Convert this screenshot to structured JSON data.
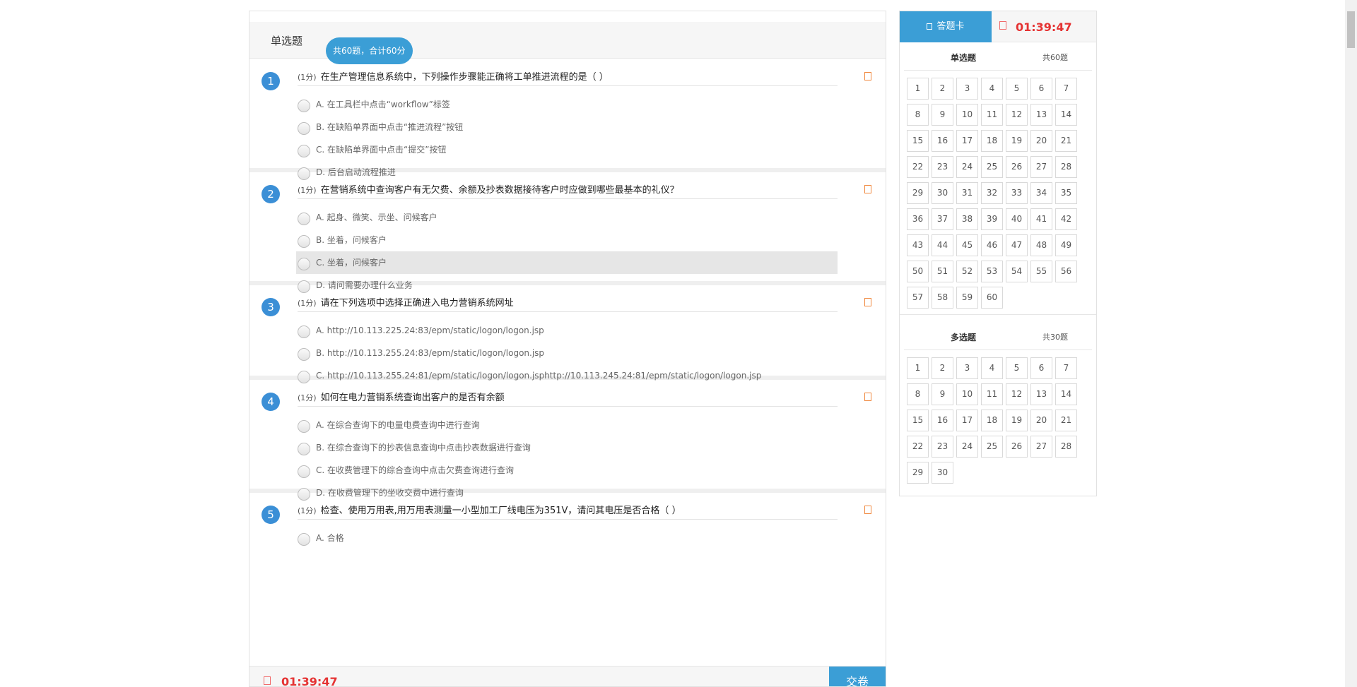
{
  "section": {
    "title": "单选题",
    "summary": "共60题，合计60分"
  },
  "questions": [
    {
      "num": "1",
      "score": "(1分)",
      "text": "在生产管理信息系统中，下列操作步骤能正确将工单推进流程的是（   ）",
      "options": [
        "A. 在工具栏中点击“workflow”标签",
        "B. 在缺陷单界面中点击“推进流程”按钮",
        "C. 在缺陷单界面中点击“提交”按钮",
        "D. 后台启动流程推进"
      ]
    },
    {
      "num": "2",
      "score": "(1分)",
      "text": "在营销系统中查询客户有无欠费、余额及抄表数据接待客户时应做到哪些最基本的礼仪？",
      "options": [
        "A. 起身、微笑、示坐、问候客户",
        "B. 坐着，问候客户",
        "C. 坐着，问候客户",
        "D. 请问需要办理什么业务"
      ]
    },
    {
      "num": "3",
      "score": "(1分)",
      "text": "请在下列选项中选择正确进入电力营销系统网址",
      "options": [
        "A. http://10.113.225.24:83/epm/static/logon/logon.jsp",
        "B. http://10.113.255.24:83/epm/static/logon/logon.jsp",
        "C. http://10.113.255.24:81/epm/static/logon/logon.jsphttp://10.113.245.24:81/epm/static/logon/logon.jsp"
      ]
    },
    {
      "num": "4",
      "score": "(1分)",
      "text": "如何在电力营销系统查询出客户的是否有余额",
      "options": [
        "A. 在综合查询下的电量电费查询中进行查询",
        "B. 在综合查询下的抄表信息查询中点击抄表数据进行查询",
        "C. 在收费管理下的综合查询中点击欠费查询进行查询",
        "D. 在收费管理下的坐收交费中进行查询"
      ]
    },
    {
      "num": "5",
      "score": "(1分)",
      "text": "检查、使用万用表,用万用表测量一小型加工厂线电压为351V，请问其电压是否合格（   ）",
      "options": [
        "A. 合格"
      ]
    }
  ],
  "footer": {
    "timer": "01:39:47",
    "submit_label": "交卷"
  },
  "card": {
    "tab_label": "答题卡",
    "timer": "01:39:47",
    "single": {
      "title": "单选题",
      "count": "共60题",
      "total": 60
    },
    "multi": {
      "title": "多选题",
      "count": "共30题",
      "total": 30
    }
  },
  "colors": {
    "accent": "#3b9ed6",
    "timer": "#e53333",
    "flag": "#f0883e"
  },
  "icons": {
    "flag": "bookmark-icon",
    "clock": "clock-icon",
    "card": "card-icon"
  }
}
